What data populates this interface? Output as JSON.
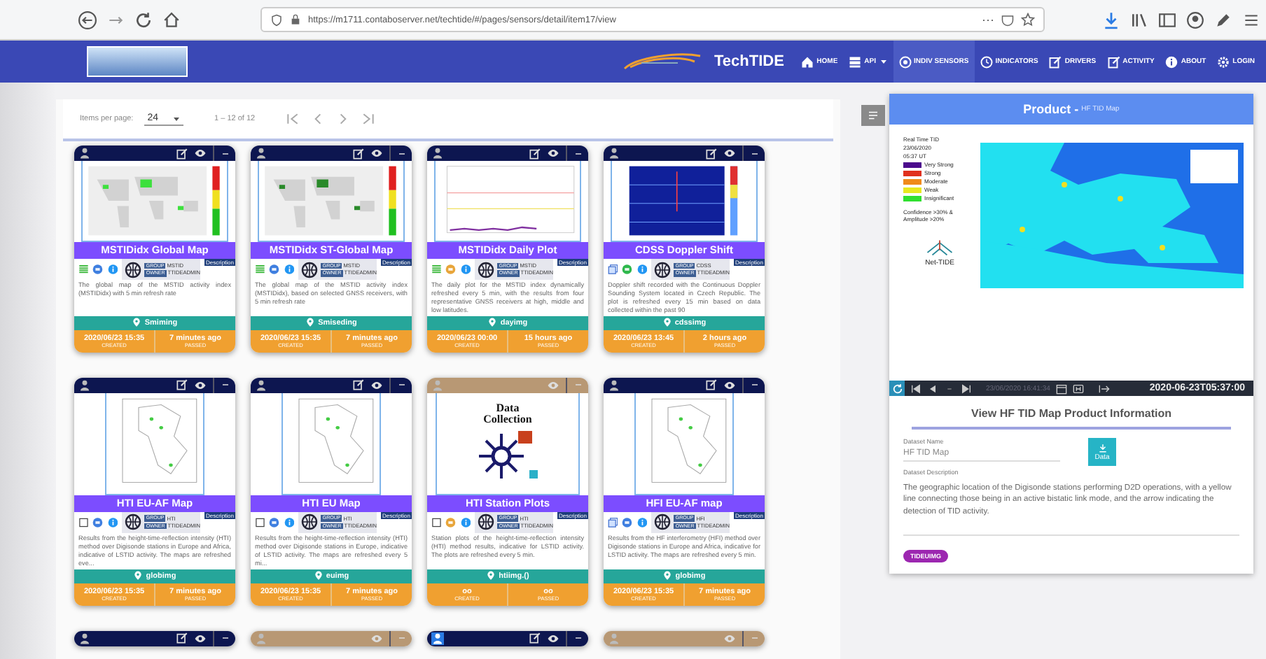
{
  "browser": {
    "url": "https://m1711.contaboserver.net/techtide/#/pages/sensors/detail/item17/view",
    "more": "···"
  },
  "nav": {
    "brand": "TechTIDE",
    "items": [
      {
        "label": "HOME",
        "kind": "home",
        "dropdown": false,
        "selected": false
      },
      {
        "label": "API",
        "kind": "api",
        "dropdown": true,
        "selected": false
      },
      {
        "label": "INDIV SENSORS",
        "kind": "target",
        "dropdown": false,
        "selected": true
      },
      {
        "label": "INDICATORS",
        "kind": "clock",
        "dropdown": false,
        "selected": false
      },
      {
        "label": "DRIVERS",
        "kind": "edit",
        "dropdown": false,
        "selected": false
      },
      {
        "label": "ACTIVITY",
        "kind": "edit",
        "dropdown": false,
        "selected": false
      },
      {
        "label": "ABOUT",
        "kind": "info",
        "dropdown": false,
        "selected": false
      },
      {
        "label": "LOGIN",
        "kind": "gear",
        "dropdown": false,
        "selected": false
      }
    ]
  },
  "toolbar": {
    "items_per_page_label": "Items per page:",
    "page_size": "24",
    "range": "1 – 12 of 12"
  },
  "cards": [
    {
      "editable": true,
      "user_active": false,
      "image": {
        "kind": "world-map"
      },
      "title": "MSTIDidx Global Map",
      "type_icon": {
        "kind": "layers"
      },
      "status": {
        "color": "#3f7fe0"
      },
      "group_label": "GROUP",
      "group": "MSTID",
      "owner_label": "OWNER",
      "owner": "TTIDEADMIN",
      "tag": "Description",
      "description": "The global map of the MSTID activity index (MSTIDidx) with 5 min refresh rate",
      "location": "Smiming",
      "created": "2020/06/23 15:35",
      "created_label": "CREATED",
      "passed": "7 minutes ago",
      "passed_label": "PASSED"
    },
    {
      "editable": true,
      "user_active": false,
      "image": {
        "kind": "world-map"
      },
      "title": "MSTIDidx ST-Global Map",
      "type_icon": {
        "kind": "layers"
      },
      "status": {
        "color": "#3f7fe0"
      },
      "group_label": "GROUP",
      "group": "MSTID",
      "owner_label": "OWNER",
      "owner": "TTIDEADMIN",
      "tag": "Description",
      "description": "The global map of the MSTID activity index (MSTIDidx), based on selected GNSS receivers, with 5 min refresh rate",
      "location": "Smiseding",
      "created": "2020/06/23 15:35",
      "created_label": "CREATED",
      "passed": "7 minutes ago",
      "passed_label": "PASSED"
    },
    {
      "editable": true,
      "user_active": false,
      "image": {
        "kind": "line-plot"
      },
      "title": "MSTIDidx Daily Plot",
      "type_icon": {
        "kind": "layers"
      },
      "status": {
        "color": "#e8a53a"
      },
      "group_label": "GROUP",
      "group": "MSTID",
      "owner_label": "OWNER",
      "owner": "TTIDEADMIN",
      "tag": "Description",
      "description": "The daily plot for the MSTID index dynamically refreshed every 5 min, with the results from four representative GNSS receivers at high, middle and low latitudes.",
      "location": "dayimg",
      "created": "2020/06/23 00:00",
      "created_label": "CREATED",
      "passed": "15 hours ago",
      "passed_label": "PASSED"
    },
    {
      "editable": true,
      "user_active": false,
      "image": {
        "kind": "spectrogram"
      },
      "title": "CDSS Doppler Shift",
      "type_icon": {
        "kind": "copy"
      },
      "status": {
        "color": "#2eb84c"
      },
      "group_label": "GROUP",
      "group": "CDSS",
      "owner_label": "OWNER",
      "owner": "TTIDEADMIN",
      "tag": "Description",
      "description": "Doppler shift recorded with the Continuous Doppler Sounding System located in Czech Republic. The plot is refreshed every 15 min based on data collected within the past 90",
      "location": "cdssimg",
      "created": "2020/06/23 13:45",
      "created_label": "CREATED",
      "passed": "2 hours ago",
      "passed_label": "PASSED"
    },
    {
      "editable": true,
      "user_active": false,
      "image": {
        "kind": "region-map"
      },
      "title": "HTI EU-AF Map",
      "type_icon": {
        "kind": "checkbox"
      },
      "status": {
        "color": "#3f7fe0"
      },
      "group_label": "GROUP",
      "group": "HTI",
      "owner_label": "OWNER",
      "owner": "TTIDEADMIN",
      "tag": "Description",
      "description": "Results from the height-time-reflection intensity (HTI) method over Digisonde stations in Europe and Africa, indicative of LSTID activity. The maps are refreshed eve...",
      "location": "globimg",
      "created": "2020/06/23 15:35",
      "created_label": "CREATED",
      "passed": "7 minutes ago",
      "passed_label": "PASSED"
    },
    {
      "editable": true,
      "user_active": false,
      "image": {
        "kind": "region-map"
      },
      "title": "HTI EU Map",
      "type_icon": {
        "kind": "checkbox"
      },
      "status": {
        "color": "#3f7fe0"
      },
      "group_label": "GROUP",
      "group": "HTI",
      "owner_label": "OWNER",
      "owner": "TTIDEADMIN",
      "tag": "Description",
      "description": "Results from the height-time-reflection intensity (HTI) method over Digisonde stations in Europe, indicative of LSTID activity. The maps are refreshed every 5 mi...",
      "location": "euimg",
      "created": "2020/06/23 15:35",
      "created_label": "CREATED",
      "passed": "7 minutes ago",
      "passed_label": "PASSED"
    },
    {
      "editable": false,
      "user_active": false,
      "image": {
        "kind": "data-collection",
        "caption_lines": [
          "Data",
          "Collection"
        ]
      },
      "title": "HTI Station Plots",
      "type_icon": {
        "kind": "checkbox"
      },
      "status": {
        "color": "#e8a53a"
      },
      "group_label": "GROUP",
      "group": "HTI",
      "owner_label": "OWNER",
      "owner": "TTIDEADMIN",
      "tag": "Description",
      "description": "Station plots of the height-time-reflection intensity (HTI) method results, indicative for LSTID activity. The plots are refreshed every 5 min.",
      "location": "htiimg.()",
      "created": "oo",
      "created_label": "CREATED",
      "passed": "oo",
      "passed_label": "PASSED"
    },
    {
      "editable": true,
      "user_active": false,
      "image": {
        "kind": "region-map"
      },
      "title": "HFI EU-AF map",
      "type_icon": {
        "kind": "copy"
      },
      "status": {
        "color": "#3f7fe0"
      },
      "group_label": "GROUP",
      "group": "HFI",
      "owner_label": "OWNER",
      "owner": "TTIDEADMIN",
      "tag": "Description",
      "description": "Results from the HF interferometry (HFI) method over Digisonde stations in Europe and Africa, indicative for LSTID activity. The maps are refreshed every 5 min.",
      "location": "globimg",
      "created": "2020/06/23 15:35",
      "created_label": "CREATED",
      "passed": "7 minutes ago",
      "passed_label": "PASSED"
    },
    {
      "editable": true,
      "user_active": false
    },
    {
      "editable": false,
      "user_active": false
    },
    {
      "editable": true,
      "user_active": true
    },
    {
      "editable": false,
      "user_active": false
    }
  ],
  "product": {
    "title": "Product - ",
    "subtitle": "HF TID Map",
    "legend": {
      "heading": "Real Time TID",
      "date": "23/06/2020",
      "time": "05:37 UT",
      "levels": [
        {
          "label": "Very Strong",
          "color": "#4b0a8c"
        },
        {
          "label": "Strong",
          "color": "#e0301e"
        },
        {
          "label": "Moderate",
          "color": "#f08a1a"
        },
        {
          "label": "Weak",
          "color": "#e8e820"
        },
        {
          "label": "Insignificant",
          "color": "#30e030"
        }
      ],
      "note": "Confidence >30% & Amplitude >20%",
      "logo": "Net-TIDE"
    },
    "timeline": {
      "current": "23/06/2020 16:41:34",
      "selected": "2020-06-23T05:37:00"
    },
    "info_title": "View HF TID Map Product Information",
    "name_label": "Dataset Name",
    "name_value": "HF TID Map",
    "data_button": "Data",
    "description_label": "Dataset Description",
    "description": "The geographic location of the Digisonde stations performing D2D operations, with a yellow line connecting those being in an active bistatic link mode, and the arrow indicating the detection of TID activity.",
    "chip": "TIDEUIMG"
  }
}
